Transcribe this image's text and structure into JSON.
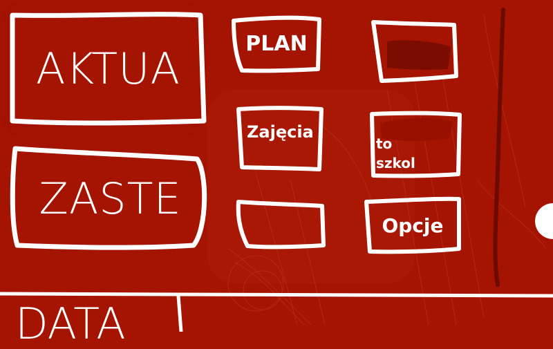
{
  "colors": {
    "background": "#a51400",
    "stroke": "#ffffff",
    "scrollbar": "#6a0a00",
    "dark_fill": "#7a0c00"
  },
  "buttons": {
    "aktua": "AKTUA",
    "zaste": "ZASTE",
    "plan": "PLAN",
    "zajecia": "Zajęcia",
    "to_szkol": "to\nszkol",
    "opcje": "Opcje"
  },
  "bottom": {
    "data_label": "DATA"
  }
}
